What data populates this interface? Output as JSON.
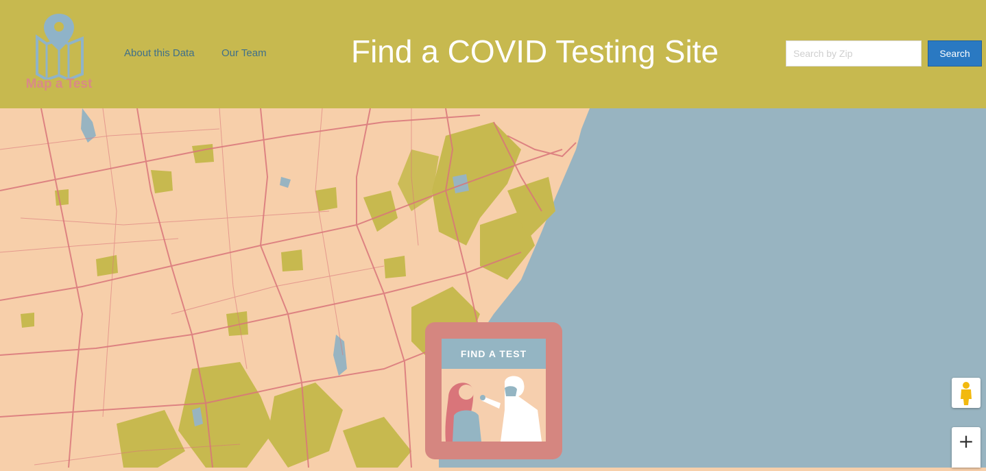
{
  "header": {
    "logo_text": "Map a Test",
    "nav": [
      {
        "label": "About this Data"
      },
      {
        "label": "Our Team"
      }
    ],
    "title": "Find a COVID Testing Site"
  },
  "search": {
    "placeholder": "Search by Zip",
    "button_label": "Search"
  },
  "map": {
    "land_color": "#f7cfaa",
    "water_color": "#98b4c1",
    "forest_color": "#c7b94f",
    "road_color": "#d9757a"
  },
  "card": {
    "banner": "FIND A TEST"
  },
  "controls": {
    "zoom_in": "+",
    "pegman_icon": "pegman-icon"
  }
}
